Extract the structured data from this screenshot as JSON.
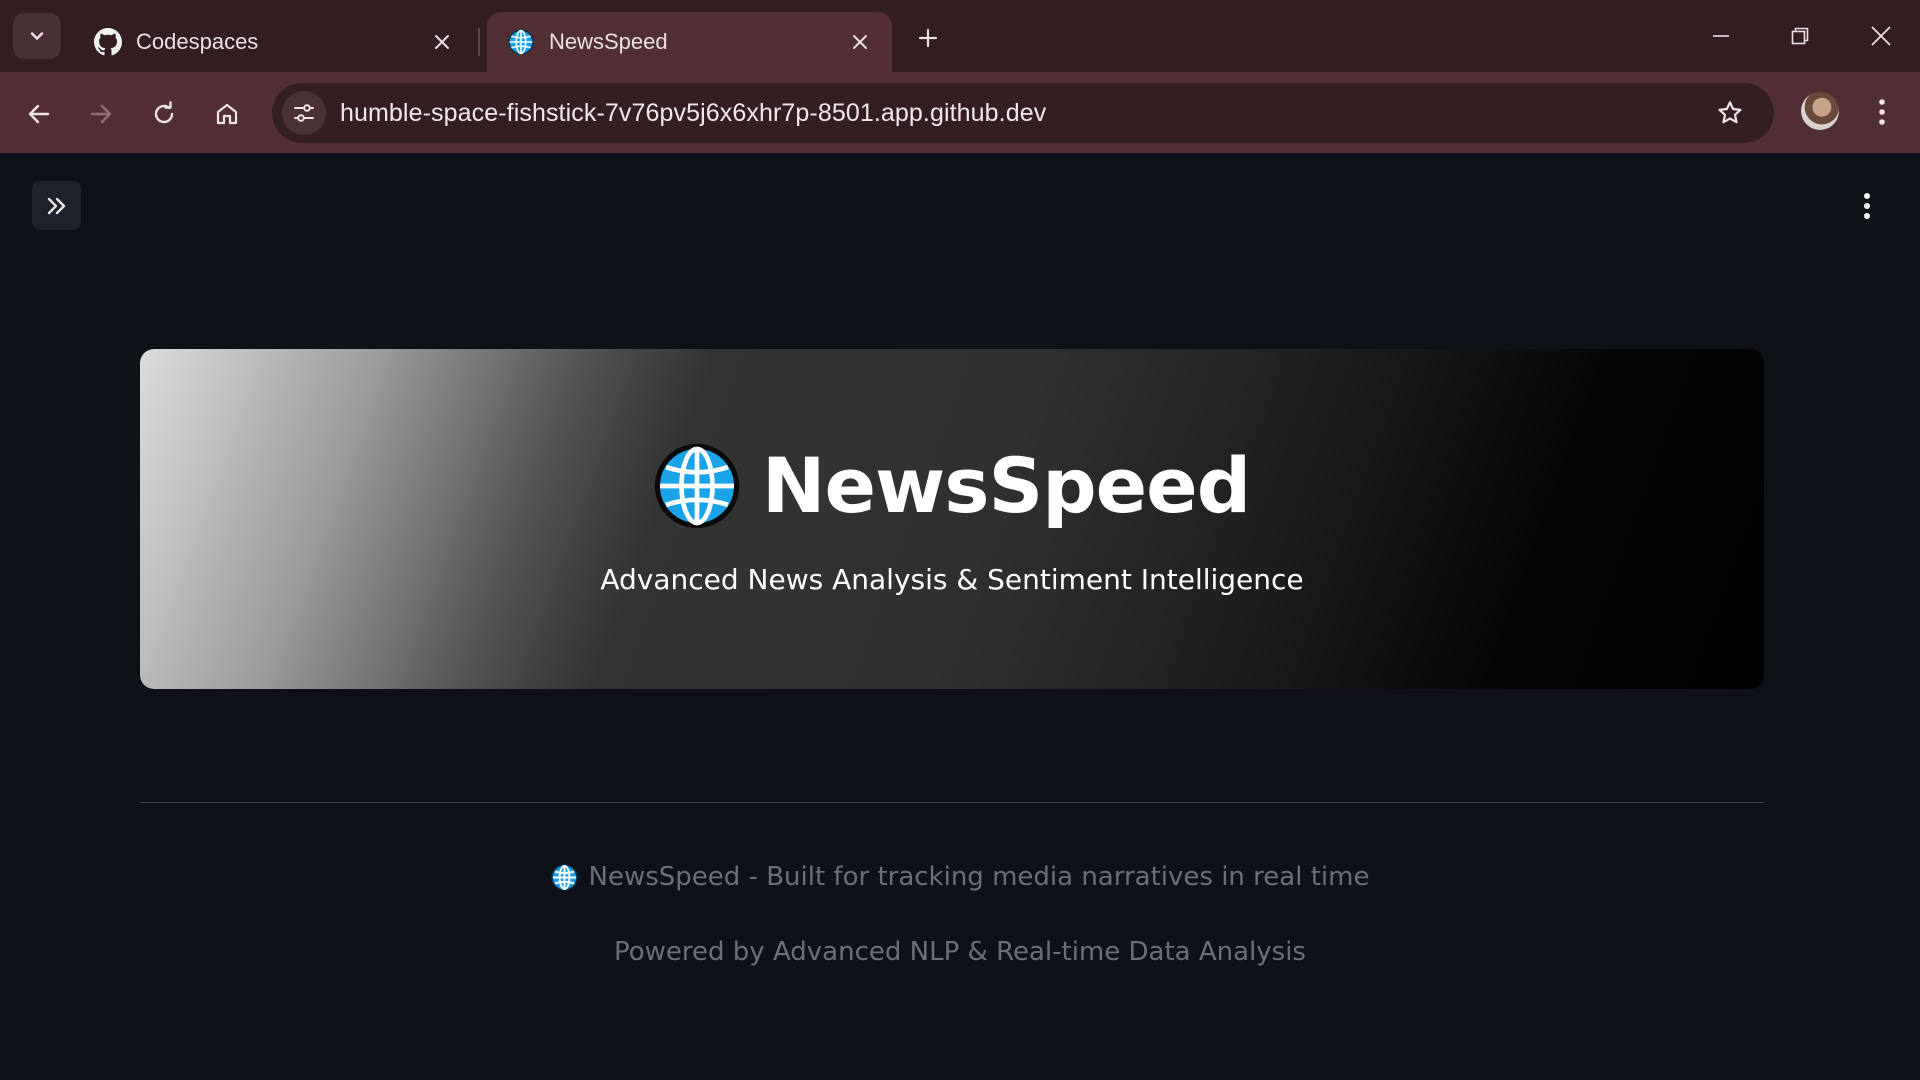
{
  "browser": {
    "tabs": [
      {
        "title": "Codespaces",
        "icon": "github-icon",
        "active": false
      },
      {
        "title": "NewsSpeed",
        "icon": "globe-icon",
        "active": true
      }
    ],
    "address_bar": {
      "url": "humble-space-fishstick-7v76pv5j6x6xhr7p-8501.app.github.dev"
    }
  },
  "hero": {
    "icon": "globe-icon",
    "title": "NewsSpeed",
    "subtitle": "Advanced News Analysis & Sentiment Intelligence"
  },
  "footer": {
    "icon": "globe-icon",
    "line1": "NewsSpeed - Built for tracking media narratives in real time",
    "line2": "Powered by Advanced NLP & Real-time Data Analysis"
  },
  "colors": {
    "page_background": "#0e1117",
    "browser_frame": "#331d21",
    "browser_toolbar": "#522f35",
    "footer_text": "#6b6f78",
    "globe_blue": "#1aa3e8"
  }
}
